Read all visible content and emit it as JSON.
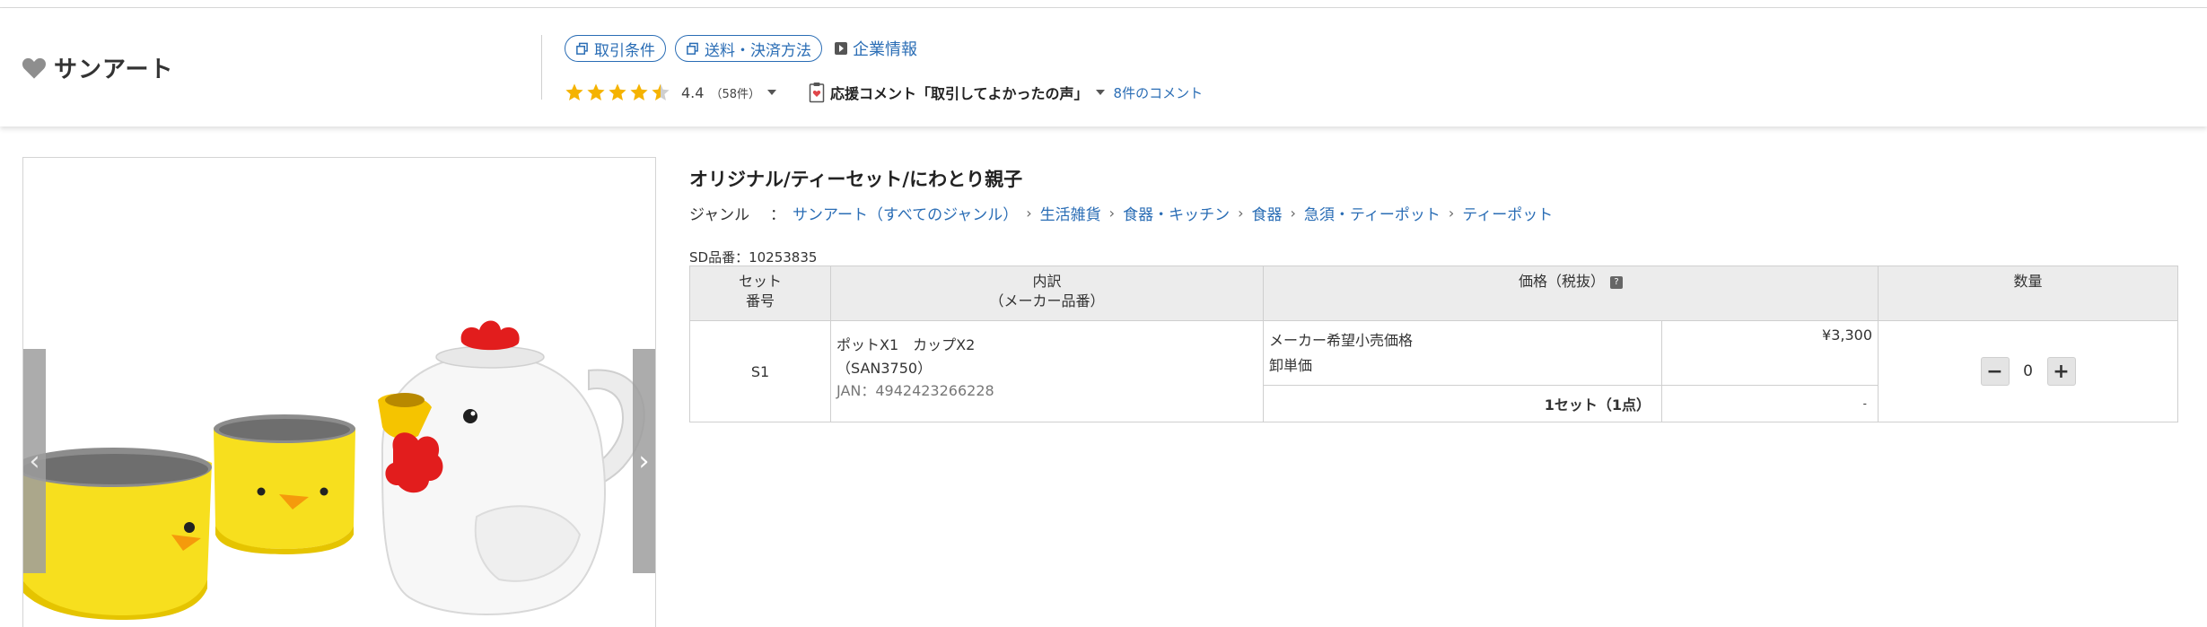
{
  "shop": {
    "name": "サンアート",
    "heart_icon": "heart-icon"
  },
  "header_links": {
    "terms": "取引条件",
    "shipping": "送料・決済方法",
    "company": "企業情報"
  },
  "rating": {
    "value": 4.4,
    "text": "4.4",
    "count": "（58件）"
  },
  "comments": {
    "title": "応援コメント「取引してよかったの声」",
    "link": "8件のコメント"
  },
  "product": {
    "title": "オリジナル/ティーセット/にわとり親子",
    "genre_label": "ジャンル",
    "genre_colon": "：",
    "breadcrumbs": [
      "サンアート（すべてのジャンル）",
      "生活雑貨",
      "食器・キッチン",
      "食器",
      "急須・ティーポット",
      "ティーポット"
    ],
    "sd_code": "SD品番：10253835"
  },
  "table": {
    "headers": {
      "set_line1": "セット",
      "set_line2": "番号",
      "detail_line1": "内訳",
      "detail_line2": "（メーカー品番）",
      "price": "価格（税抜）",
      "price_help": "?",
      "qty": "数量"
    },
    "rows": [
      {
        "set": "S1",
        "detail_line1": "ポットX1　カップX2",
        "detail_line2": "（SAN3750）",
        "jan": "JAN：4942423266228",
        "msrp_label": "メーカー希望小売価格",
        "msrp_value": "¥3,300",
        "wholesale_label": "卸単価",
        "per_set_label": "1セット（1点）",
        "per_set_value": "-",
        "qty": "0"
      }
    ]
  },
  "stepper": {
    "minus": "−",
    "plus": "+"
  },
  "gallery": {
    "prev": "‹",
    "next": "›"
  },
  "colors": {
    "link": "#2a6db5",
    "star": "#f5b301",
    "chick": "#f7df1e",
    "comb": "#e21d1d"
  }
}
